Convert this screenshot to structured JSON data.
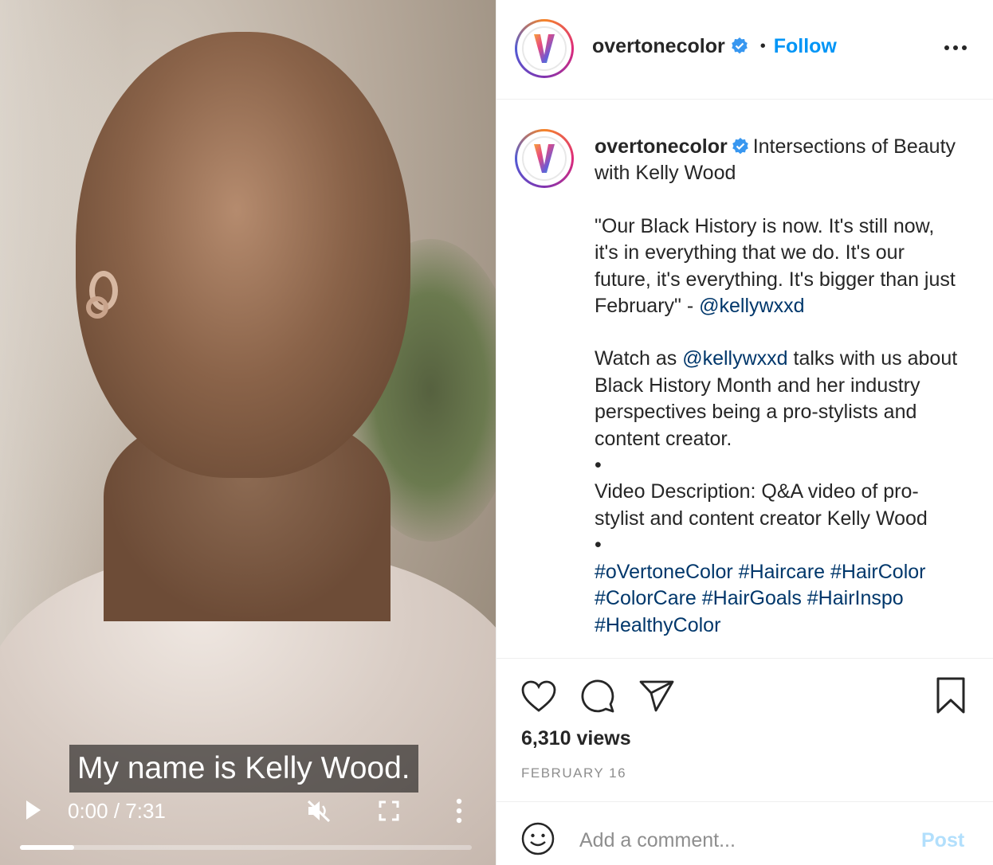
{
  "video": {
    "subtitle": "My name is Kelly Wood.",
    "time": "0:00 / 7:31",
    "progress": 0.12
  },
  "header": {
    "handle": "overtonecolor",
    "separator": "•",
    "follow_label": "Follow"
  },
  "caption": {
    "handle": "overtonecolor",
    "title": "Intersections of Beauty with Kelly Wood",
    "quote_text": "\"Our Black History is now. It's still now, it's in everything that we do. It's our future, it's everything. It's bigger than just February\" - ",
    "quote_mention": "@kellywxxd",
    "watch_prefix": "Watch as ",
    "watch_mention": "@kellywxxd",
    "watch_text": " talks with us about Black History Month and her industry perspectives being a pro-stylists and content creator.",
    "bullet1": "•",
    "description": "Video Description: Q&A video of pro-stylist and content creator Kelly Wood",
    "bullet2": "•",
    "hashtags": "#oVertoneColor #Haircare #HairColor #ColorCare #HairGoals #HairInspo #HealthyColor"
  },
  "stats": {
    "views": "6,310 views",
    "date": "FEBRUARY 16"
  },
  "comment": {
    "placeholder": "Add a comment...",
    "post_label": "Post"
  },
  "colors": {
    "accent": "#0095f6",
    "link": "#00376b",
    "muted": "#8e8e8e"
  }
}
